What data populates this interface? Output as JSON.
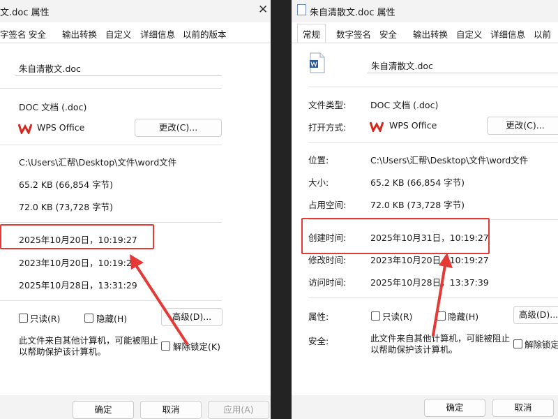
{
  "left": {
    "title": "文.doc 属性",
    "tabs": [
      "字签名",
      "安全",
      "输出转换",
      "自定义",
      "详细信息",
      "以前的版本"
    ],
    "file_name": "朱自清散文.doc",
    "file_type": "DOC 文档 (.doc)",
    "open_with": "WPS Office",
    "change_button": "更改(C)...",
    "location": "C:\\Users\\汇帮\\Desktop\\文件\\word文件",
    "size": "65.2 KB (66,854 字节)",
    "size_on_disk": "72.0 KB (73,728 字节)",
    "created": "2025年10月20日，10:19:27",
    "modified": "2023年10月20日，10:19:27",
    "accessed": "2025年10月28日，13:31:29",
    "readonly": "只读(R)",
    "hidden": "隐藏(H)",
    "advanced": "高级(D)...",
    "security_text": [
      "此文件来自其他计算机，可能被阻止",
      "以帮助保护该计算机。"
    ],
    "unblock": "解除锁定(K)",
    "ok": "确定",
    "cancel": "取消",
    "apply": "应用(A)"
  },
  "right": {
    "title": "朱自清散文.doc 属性",
    "tabs": [
      "常规",
      "数字签名",
      "安全",
      "输出转换",
      "自定义",
      "详细信息",
      "以前"
    ],
    "file_name": "朱自清散文.doc",
    "labels": {
      "file_type": "文件类型:",
      "open_with": "打开方式:",
      "location": "位置:",
      "size": "大小:",
      "size_on_disk": "占用空间:",
      "created": "创建时间:",
      "modified": "修改时间:",
      "accessed": "访问时间:",
      "attributes": "属性:",
      "security": "安全:"
    },
    "file_type": "DOC 文档 (.doc)",
    "open_with": "WPS Office",
    "change_button": "更改(C)...",
    "location": "C:\\Users\\汇帮\\Desktop\\文件\\word文件",
    "size": "65.2 KB (66,854 字节)",
    "size_on_disk": "72.0 KB (73,728 字节)",
    "created": "2025年10月31日，10:19:27",
    "modified": "2023年10月20日，10:19:27",
    "accessed": "2025年10月28日，13:37:39",
    "readonly": "只读(R)",
    "hidden": "隐藏(H)",
    "advanced": "高级(D)...",
    "security_text": [
      "此文件来自其他计算机，可能被阻止",
      "以帮助保护该计算机。"
    ],
    "unblock": "解除锁定",
    "ok": "确定",
    "cancel": "取消"
  },
  "colors": {
    "highlight": "#e53935",
    "wps_red": "#d9261c",
    "word_blue": "#2b579a"
  }
}
